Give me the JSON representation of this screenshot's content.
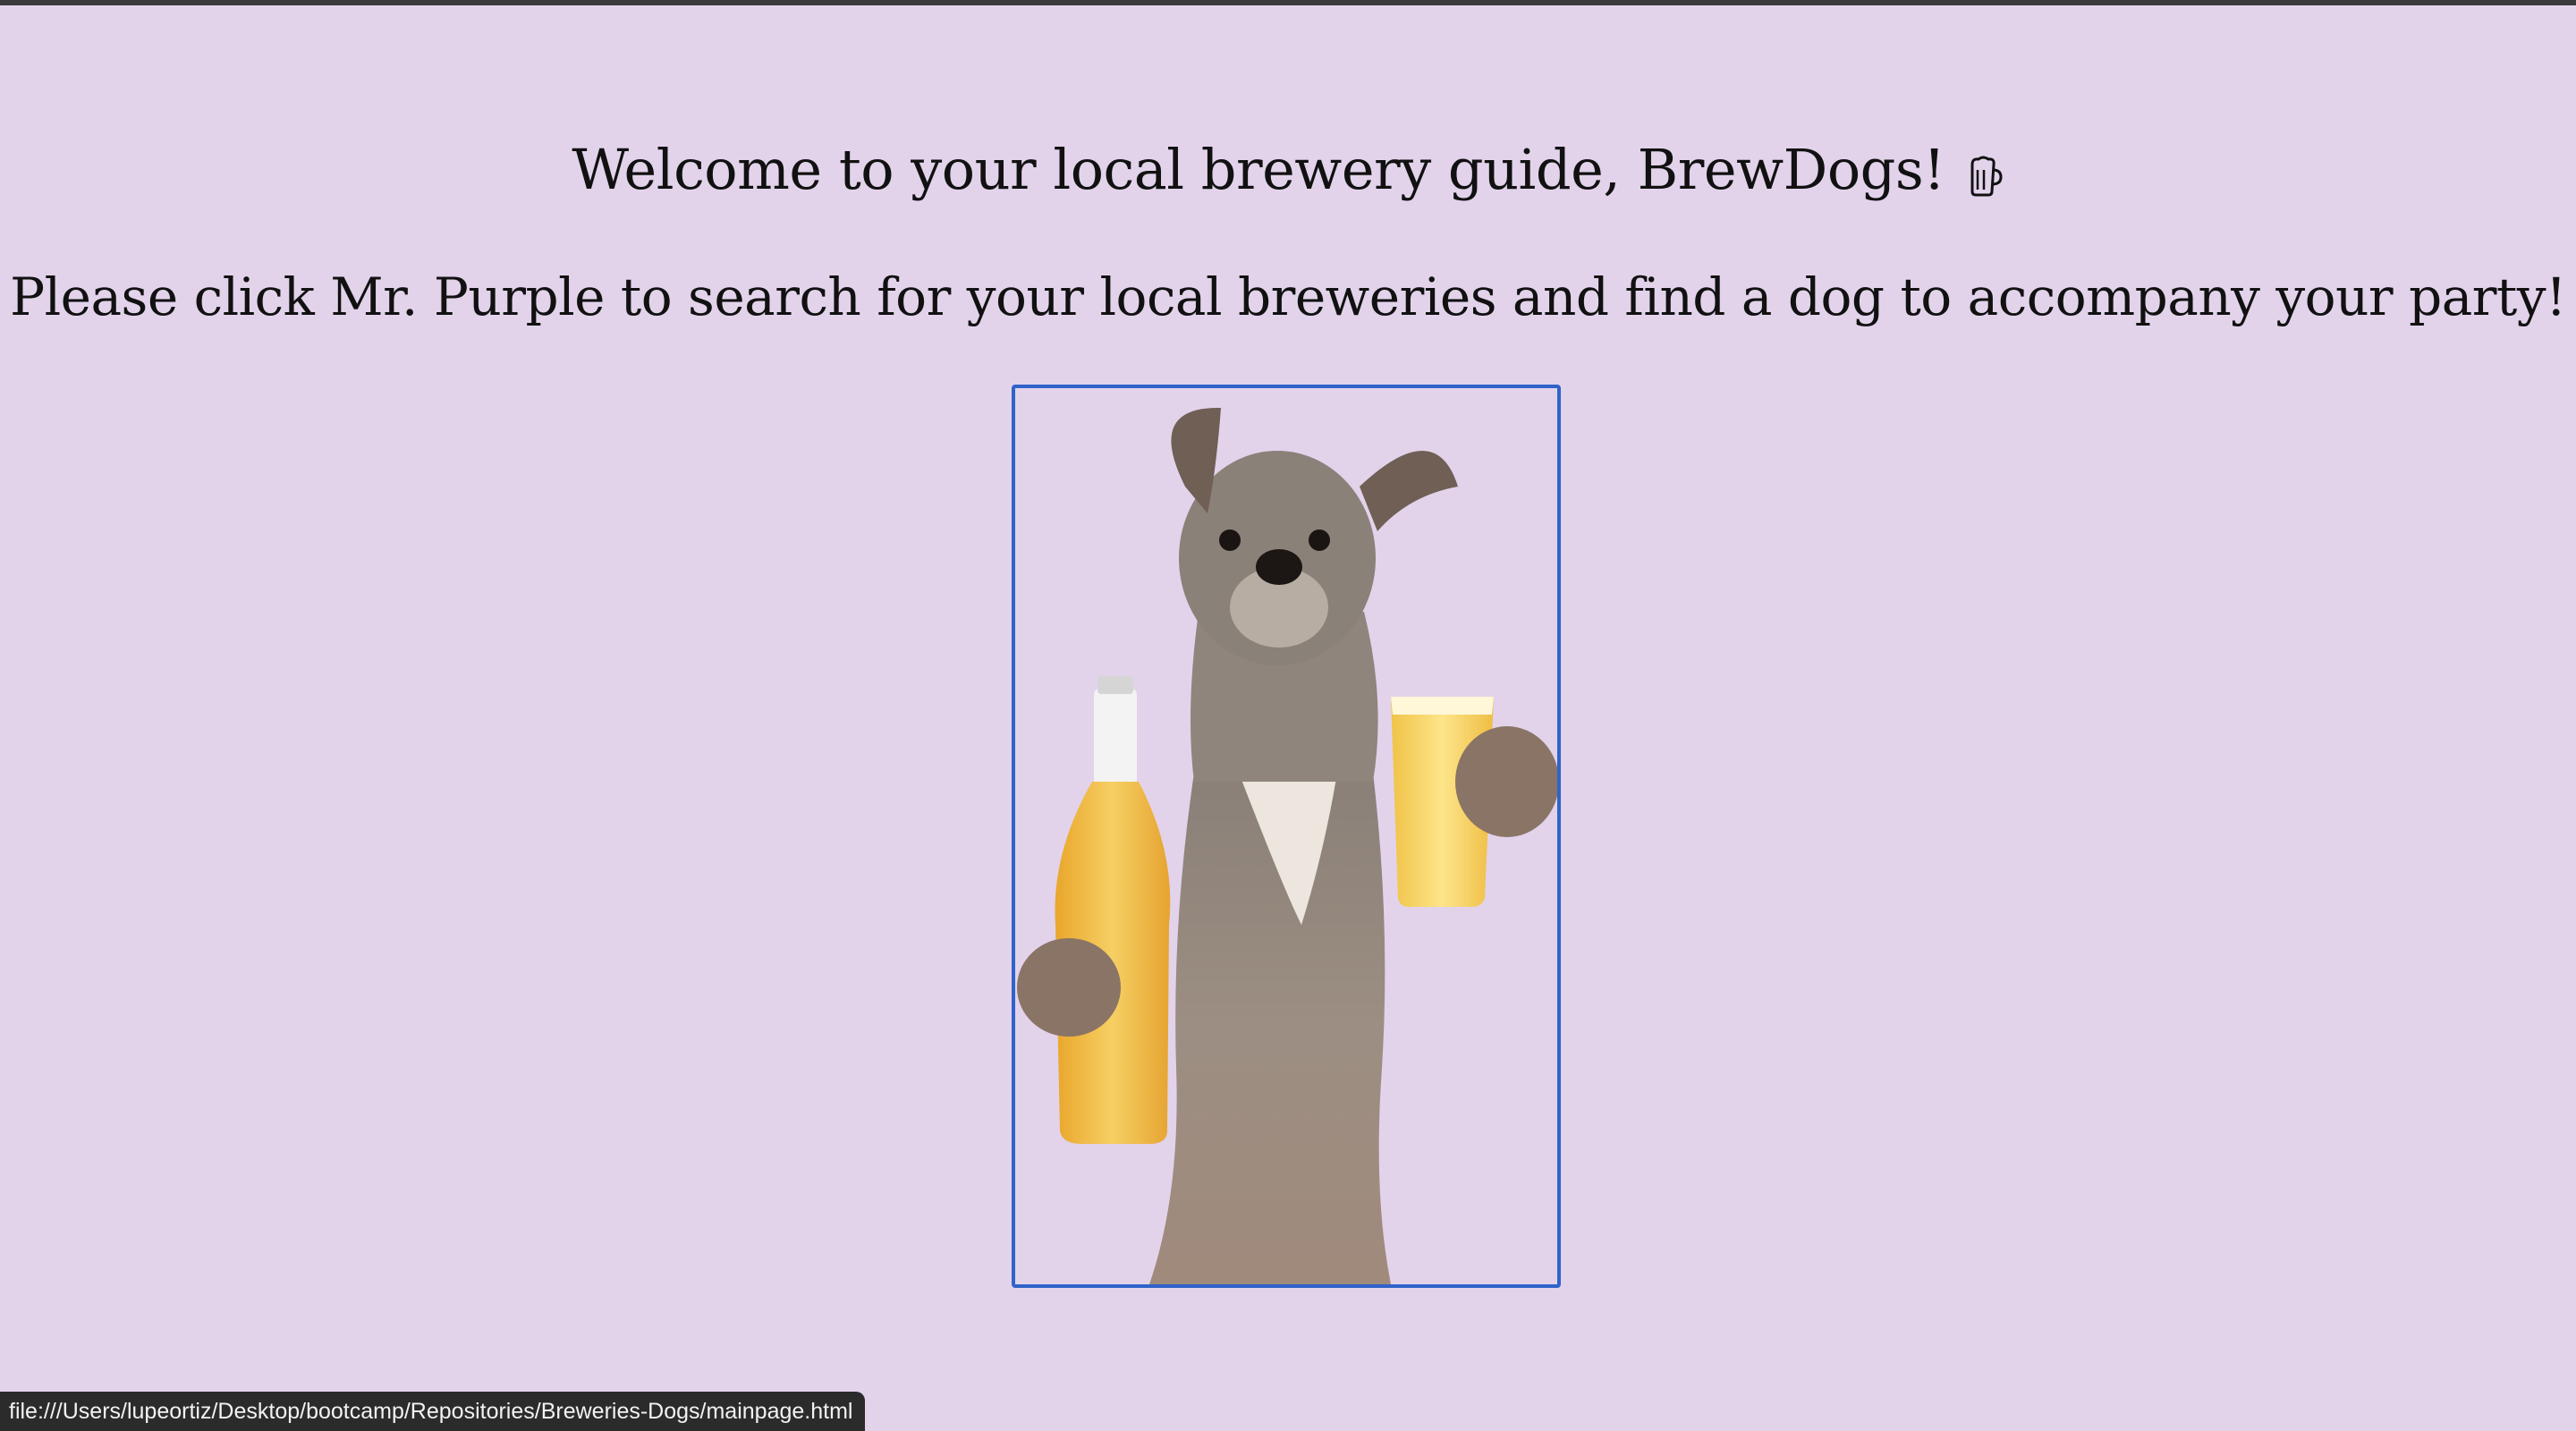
{
  "page": {
    "background": "#e2d3eb",
    "welcome": "Welcome to your local brewery guide, BrewDogs!",
    "welcome_icon": "beer-mug-icon",
    "instruction": "Please click Mr. Purple to search for your local breweries and find a dog to accompany your party!",
    "dog_image": {
      "alt": "Mr. Purple",
      "description_icon": "dog-with-beer-image",
      "border_color": "#2f63c9"
    }
  },
  "status_bar": {
    "url": "file:///Users/lupeortiz/Desktop/bootcamp/Repositories/Breweries-Dogs/mainpage.html"
  }
}
